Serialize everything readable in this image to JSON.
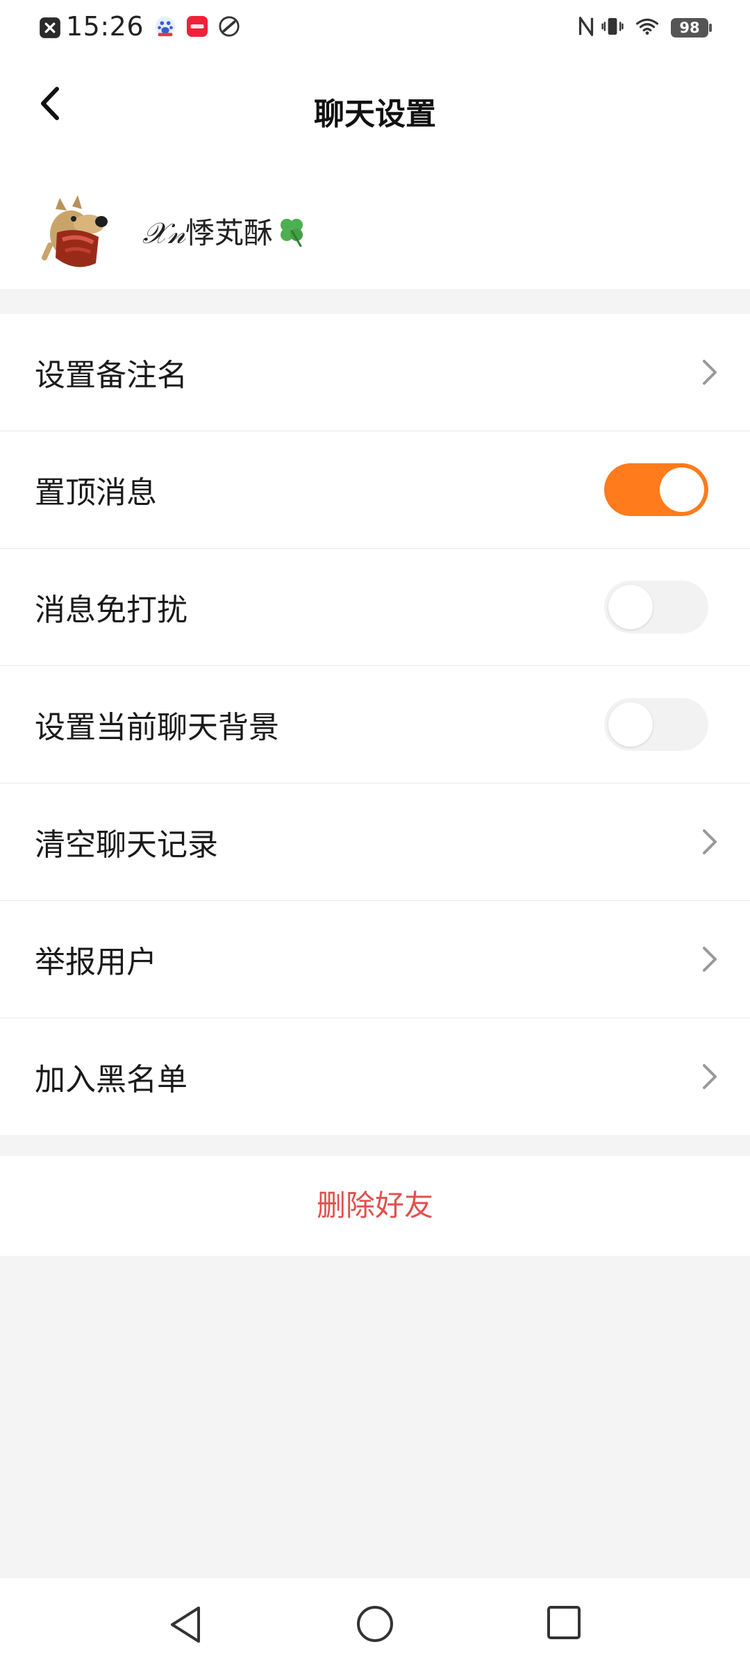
{
  "status_bar": {
    "time": "15:26",
    "battery": "98",
    "icons": [
      "close-notification-icon",
      "baidu-app-icon",
      "red-app-icon",
      "link-app-icon",
      "nfc-icon",
      "vibrate-icon",
      "wifi-icon",
      "battery-icon"
    ]
  },
  "header": {
    "title": "聊天设置",
    "back_icon": "chevron-left-icon"
  },
  "profile": {
    "nickname_script": "𝒳𝓃",
    "nickname_text": "悸芄酥",
    "nickname_emoji": "clover-icon"
  },
  "settings": {
    "items": [
      {
        "label": "设置备注名",
        "control": "chevron"
      },
      {
        "label": "置顶消息",
        "control": "toggle",
        "on": true
      },
      {
        "label": "消息免打扰",
        "control": "toggle",
        "on": false
      },
      {
        "label": "设置当前聊天背景",
        "control": "toggle",
        "on": false
      },
      {
        "label": "清空聊天记录",
        "control": "chevron"
      },
      {
        "label": "举报用户",
        "control": "chevron"
      },
      {
        "label": "加入黑名单",
        "control": "chevron"
      }
    ]
  },
  "actions": {
    "delete_label": "删除好友"
  },
  "colors": {
    "accent": "#ff7b1c",
    "danger": "#e0504d",
    "background": "#f4f4f5"
  },
  "system_nav": {
    "icons": [
      "back-triangle-icon",
      "home-circle-icon",
      "recents-square-icon"
    ]
  }
}
